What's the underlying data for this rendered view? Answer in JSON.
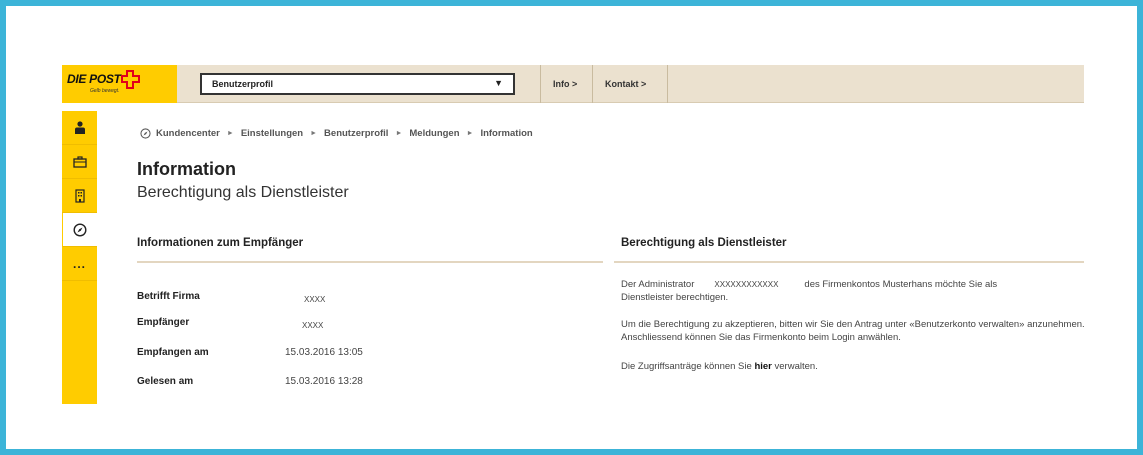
{
  "colors": {
    "frame": "#3cb4d8",
    "brand_yellow": "#ffcc00",
    "header_beige": "#ebe1cf",
    "accent_red": "#e2001a"
  },
  "logo": {
    "text": "DIE POST",
    "tagline": "Gelb bewegt."
  },
  "header": {
    "select_value": "Benutzerprofil",
    "info_label": "Info >",
    "kontakt_label": "Kontakt >"
  },
  "sidebar": {
    "items": [
      {
        "icon": "person-icon"
      },
      {
        "icon": "briefcase-icon"
      },
      {
        "icon": "building-icon"
      },
      {
        "icon": "compass-icon",
        "active": true
      },
      {
        "icon": "more-icon",
        "label": "..."
      }
    ]
  },
  "breadcrumb": [
    "Kundencenter",
    "Einstellungen",
    "Benutzerprofil",
    "Meldungen",
    "Information"
  ],
  "page": {
    "title": "Information",
    "subtitle": "Berechtigung als Dienstleister"
  },
  "recipient": {
    "title": "Informationen zum Empfänger",
    "rows": [
      {
        "label": "Betrifft Firma",
        "value": "XXXX"
      },
      {
        "label": "Empfänger",
        "value": "XXXX"
      },
      {
        "label": "Empfangen am",
        "value": "15.03.2016 13:05"
      },
      {
        "label": "Gelesen am",
        "value": "15.03.2016 13:28"
      }
    ]
  },
  "authorization": {
    "title": "Berechtigung als Dienstleister",
    "p1_a": "Der Administrator",
    "p1_x": "XXXXXXXXXXXX",
    "p1_b": "des Firmenkontos Musterhans möchte Sie als",
    "p1_c": "Dienstleister berechtigen.",
    "p2": "Um die Berechtigung zu akzeptieren, bitten wir Sie den Antrag unter «Benutzerkonto verwalten» anzunehmen. Anschliessend können Sie das Firmenkonto beim Login anwählen.",
    "p3_a": "Die Zugriffsanträge können Sie",
    "p3_link": "hier",
    "p3_b": "verwalten."
  }
}
